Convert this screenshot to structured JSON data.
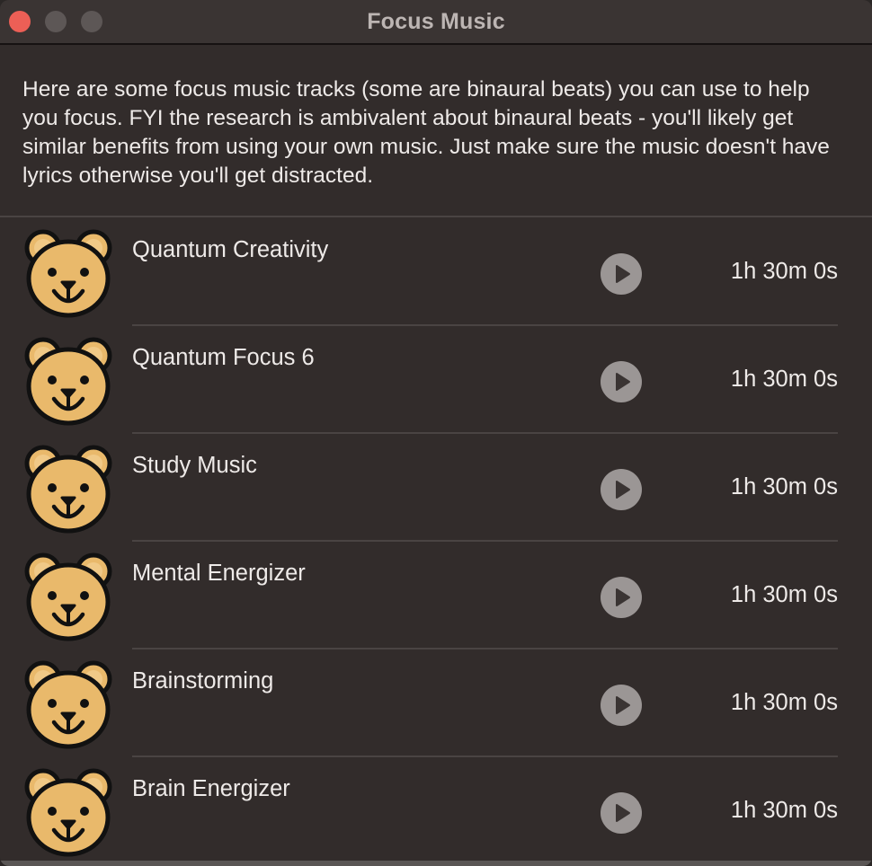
{
  "window": {
    "title": "Focus Music"
  },
  "intro": {
    "text": "Here are some focus music tracks (some are binaural beats) you can use to help you focus. FYI the research is ambivalent about binaural beats - you'll likely get similar benefits from using your own music. Just make sure the music doesn't have lyrics otherwise you'll get distracted."
  },
  "tracks": [
    {
      "title": "Quantum Creativity",
      "duration": "1h 30m 0s",
      "icon": "bear-icon",
      "action_icon": "play-icon"
    },
    {
      "title": "Quantum Focus 6",
      "duration": "1h 30m 0s",
      "icon": "bear-icon",
      "action_icon": "play-icon"
    },
    {
      "title": "Study Music",
      "duration": "1h 30m 0s",
      "icon": "bear-icon",
      "action_icon": "play-icon"
    },
    {
      "title": "Mental Energizer",
      "duration": "1h 30m 0s",
      "icon": "bear-icon",
      "action_icon": "play-icon"
    },
    {
      "title": "Brainstorming",
      "duration": "1h 30m 0s",
      "icon": "bear-icon",
      "action_icon": "play-icon"
    },
    {
      "title": "Brain Energizer",
      "duration": "1h 30m 0s",
      "icon": "bear-icon",
      "action_icon": "play-icon"
    }
  ],
  "colors": {
    "close_button": "#ec5f56",
    "bear_fill": "#e9b96b",
    "bear_outline": "#111111",
    "play_button": "#9b9695",
    "background": "#322c2b"
  }
}
